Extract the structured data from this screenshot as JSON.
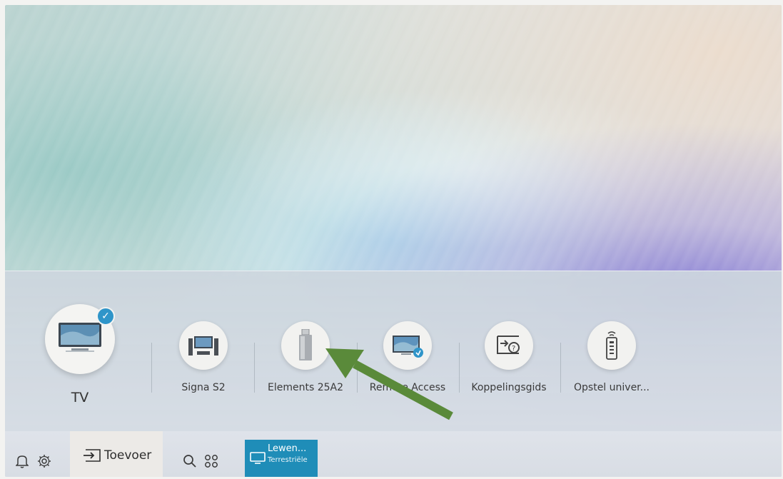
{
  "main_source": {
    "label": "TV",
    "selected": true,
    "icon": "tv-icon"
  },
  "sources": [
    {
      "label": "Signa S2",
      "icon": "home-theater-icon"
    },
    {
      "label": "Elements 25A2",
      "icon": "usb-drive-icon"
    },
    {
      "label": "Remote Access",
      "icon": "remote-access-icon"
    },
    {
      "label": "Koppelingsgids",
      "icon": "connection-guide-icon"
    },
    {
      "label": "Opstel univer...",
      "icon": "universal-remote-icon"
    }
  ],
  "bottom_bar": {
    "toevoer_label": "Toevoer",
    "live_title": "Lewen...",
    "live_subtitle": "Terrestriële"
  },
  "colors": {
    "accent": "#2f95c9",
    "live_tile": "#1f8db8",
    "annotation_arrow": "#5a8a3a"
  }
}
